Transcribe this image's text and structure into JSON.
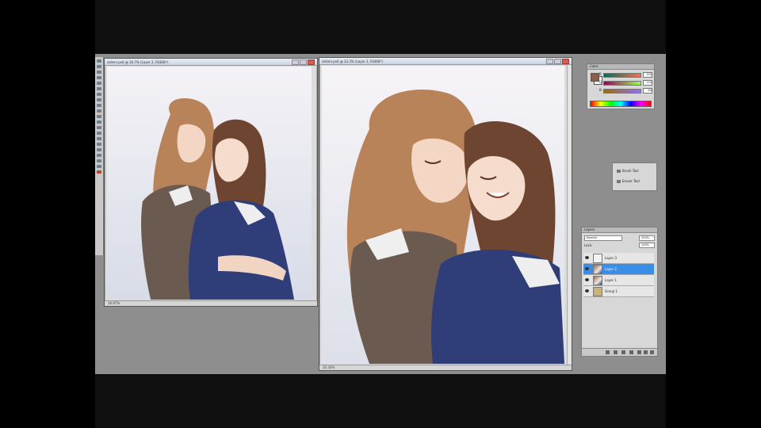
{
  "doc_small": {
    "title": "sisters.psd @ 16.7% (Layer 2, RGB/8*)",
    "status": "16.67%"
  },
  "doc_large": {
    "title": "sisters.psd @ 33.3% (Layer 2, RGB/8*)",
    "status": "33.33%"
  },
  "color_panel": {
    "tab": "Color",
    "channels": [
      {
        "label": "R",
        "value": "152"
      },
      {
        "label": "G",
        "value": "110"
      },
      {
        "label": "B",
        "value": "84"
      }
    ],
    "foreground": "#8c5e44",
    "background": "#ffffff"
  },
  "history_panel": {
    "items": [
      "Brush Tool",
      "Eraser Tool"
    ]
  },
  "layers_panel": {
    "tab": "Layers",
    "blend_mode": "Normal",
    "opacity": "100%",
    "lock_label": "Lock:",
    "fill": "100%",
    "layers": [
      {
        "name": "Layer 3",
        "selected": false,
        "thumb": "blank"
      },
      {
        "name": "Layer 2",
        "selected": true,
        "thumb": "paint"
      },
      {
        "name": "Layer 1",
        "selected": false,
        "thumb": "paint"
      },
      {
        "name": "Group 1",
        "selected": false,
        "thumb": "folder"
      }
    ]
  },
  "colors": {
    "workspace": "#8e8e8e",
    "selection": "#3b8ee8",
    "hair_light": "#b9835a",
    "hair_dark": "#6e4530",
    "dress_blue": "#2f3d78",
    "cardigan": "#6b5a50"
  }
}
